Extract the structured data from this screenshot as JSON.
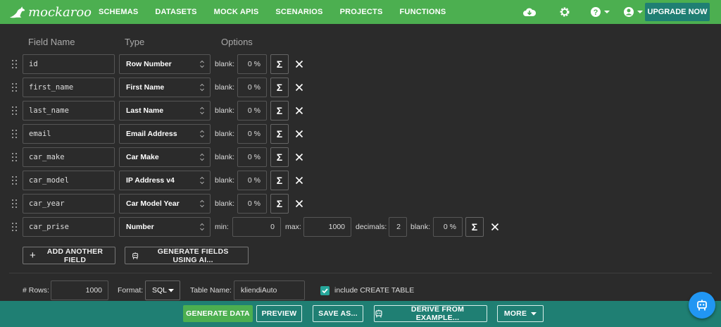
{
  "brand": {
    "name": "mockaroo"
  },
  "nav": {
    "items": [
      "SCHEMAS",
      "DATASETS",
      "MOCK APIS",
      "SCENARIOS",
      "PROJECTS",
      "FUNCTIONS"
    ],
    "upgrade": "UPGRADE NOW"
  },
  "headers": {
    "field_name": "Field Name",
    "type": "Type",
    "options": "Options"
  },
  "labels": {
    "blank": "blank:",
    "min": "min:",
    "max": "max:",
    "decimals": "decimals:",
    "sigma": "Σ"
  },
  "fields": [
    {
      "name": "id",
      "type": "Row Number",
      "blank": "0 %"
    },
    {
      "name": "first_name",
      "type": "First Name",
      "blank": "0 %"
    },
    {
      "name": "last_name",
      "type": "Last Name",
      "blank": "0 %"
    },
    {
      "name": "email",
      "type": "Email Address",
      "blank": "0 %"
    },
    {
      "name": "car_make",
      "type": "Car Make",
      "blank": "0 %"
    },
    {
      "name": "car_model",
      "type": "IP Address v4",
      "blank": "0 %"
    },
    {
      "name": "car_year",
      "type": "Car Model Year",
      "blank": "0 %"
    },
    {
      "name": "car_prise",
      "type": "Number",
      "min": "0",
      "max": "1000",
      "decimals": "2",
      "blank": "0 %"
    }
  ],
  "actions": {
    "add_field": "ADD ANOTHER FIELD",
    "generate_ai": "GENERATE FIELDS USING AI..."
  },
  "options": {
    "rows_label": "# Rows:",
    "rows_value": "1000",
    "format_label": "Format:",
    "format_value": "SQL",
    "table_label": "Table Name:",
    "table_value": "kliendiAuto",
    "create_table_label": "include CREATE TABLE",
    "create_table_checked": true
  },
  "bottom": {
    "generate": "GENERATE DATA",
    "preview": "PREVIEW",
    "save": "SAVE AS...",
    "derive": "DERIVE FROM EXAMPLE...",
    "more": "MORE"
  },
  "colors": {
    "topbar": "#4caf50",
    "bottombar": "#1f7f73",
    "background": "#2b2b2b",
    "fab": "#2196f3"
  },
  "icons": [
    "cloud-download-icon",
    "gear-icon",
    "help-icon",
    "account-icon",
    "robot-icon"
  ]
}
